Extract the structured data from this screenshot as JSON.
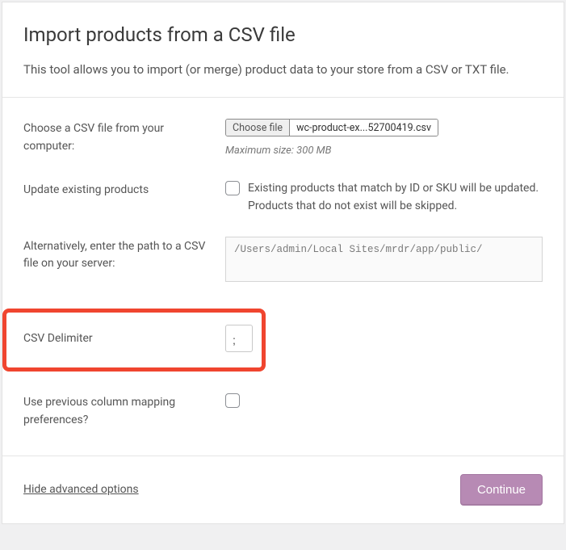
{
  "header": {
    "title": "Import products from a CSV file",
    "description": "This tool allows you to import (or merge) product data to your store from a CSV or TXT file."
  },
  "fields": {
    "file": {
      "label": "Choose a CSV file from your computer:",
      "button": "Choose file",
      "filename": "wc-product-ex...52700419.csv",
      "hint": "Maximum size: 300 MB"
    },
    "update": {
      "label": "Update existing products",
      "description": "Existing products that match by ID or SKU will be updated. Products that do not exist will be skipped."
    },
    "path": {
      "label": "Alternatively, enter the path to a CSV file on your server:",
      "value": "/Users/admin/Local Sites/mrdr/app/public/"
    },
    "delimiter": {
      "label": "CSV Delimiter",
      "value": ";"
    },
    "mapping": {
      "label": "Use previous column mapping preferences?"
    }
  },
  "footer": {
    "toggle": "Hide advanced options",
    "continue": "Continue"
  }
}
